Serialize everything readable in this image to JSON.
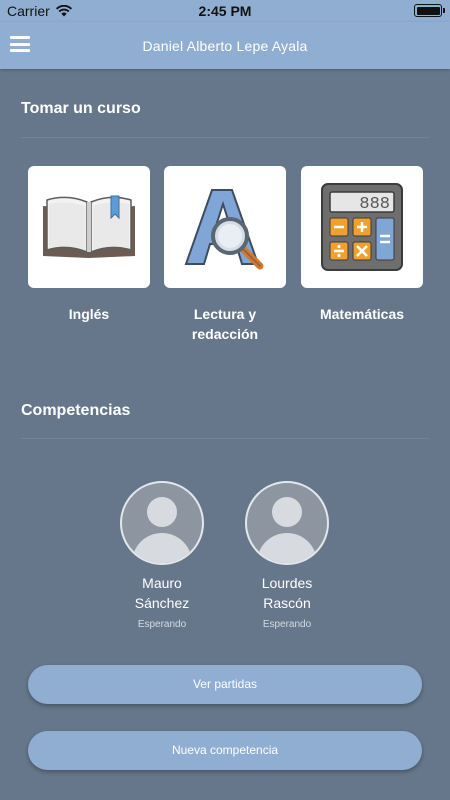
{
  "status_bar": {
    "carrier": "Carrier",
    "time": "2:45 PM"
  },
  "nav": {
    "title": "Daniel Alberto Lepe Ayala",
    "menu_icon": "hamburger-menu-icon"
  },
  "courses_section": {
    "title": "Tomar un curso",
    "items": [
      {
        "label": "Inglés",
        "icon": "open-book-icon"
      },
      {
        "label": "Lectura y redacción",
        "icon": "letter-magnifier-icon"
      },
      {
        "label": "Matemáticas",
        "icon": "calculator-icon",
        "display": "888"
      }
    ]
  },
  "competitions_section": {
    "title": "Competencias",
    "competitors": [
      {
        "first": "Mauro",
        "last": "Sánchez",
        "status": "Esperando"
      },
      {
        "first": "Lourdes",
        "last": "Rascón",
        "status": "Esperando"
      }
    ]
  },
  "buttons": {
    "view_matches": "Ver partidas",
    "new_competition": "Nueva competencia"
  },
  "colors": {
    "background": "#66778b",
    "accent": "#90aed2",
    "card": "#ffffff"
  }
}
